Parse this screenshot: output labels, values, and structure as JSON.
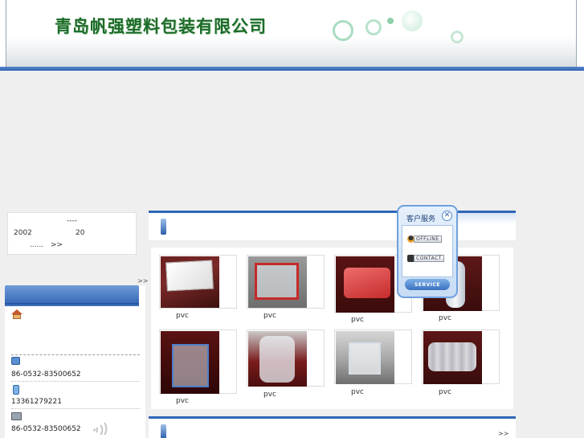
{
  "header": {
    "company_name": "青岛帆强塑料包装有限公司",
    "colors": {
      "title_green": "#1d6b2a",
      "accent_blue": "#2e62b2"
    }
  },
  "intro": {
    "dashes": "----",
    "year": "2002",
    "num": "20",
    "ellipsis": "......",
    "more": ">>"
  },
  "left_more": ">>",
  "contact": {
    "phone": "86-0532-83500652",
    "mobile": "13361279221",
    "fax": "86-0532-83500652",
    "icons": [
      "home-icon",
      "phone-icon",
      "mobile-icon",
      "fax-icon",
      "signal-icon"
    ]
  },
  "products": {
    "more": ">>",
    "items": [
      {
        "label": "pvc"
      },
      {
        "label": "pvc"
      },
      {
        "label": "pvc"
      },
      {
        "label": "pvc"
      },
      {
        "label": "pvc"
      },
      {
        "label": "pvc"
      },
      {
        "label": "pvc"
      },
      {
        "label": "pvc"
      }
    ]
  },
  "service_widget": {
    "title": "客户服务",
    "close": "✕",
    "offline": "OFFLINE",
    "contact": "CONTACT",
    "footer": "SERVICE"
  }
}
